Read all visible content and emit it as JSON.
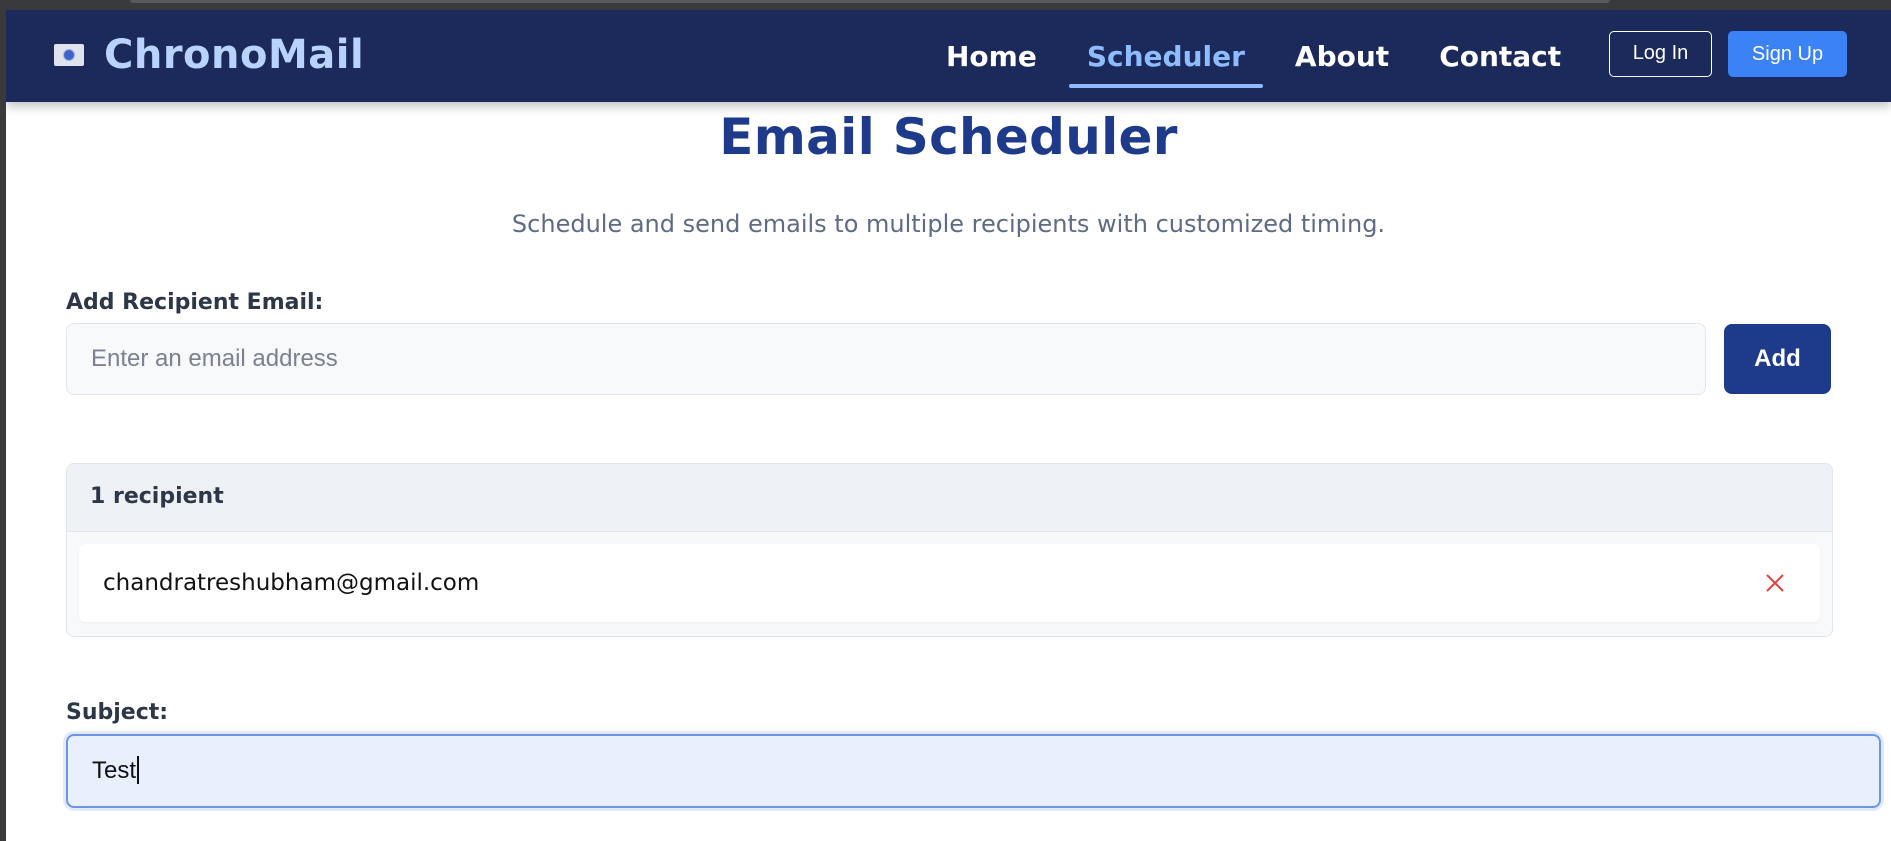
{
  "navbar": {
    "brand_icon": "envelope-icon",
    "brand_name": "ChronoMail",
    "links": [
      {
        "label": "Home",
        "active": false
      },
      {
        "label": "Scheduler",
        "active": true
      },
      {
        "label": "About",
        "active": false
      },
      {
        "label": "Contact",
        "active": false
      }
    ],
    "login_label": "Log In",
    "signup_label": "Sign Up"
  },
  "main": {
    "title": "Email Scheduler",
    "subtitle": "Schedule and send emails to multiple recipients with customized timing.",
    "recipient_label": "Add Recipient Email:",
    "recipient_placeholder": "Enter an email address",
    "add_label": "Add",
    "recipients_count": "1 recipient",
    "recipients": [
      {
        "email": "chandratreshubham@gmail.com",
        "remove_icon": "close-icon"
      }
    ],
    "subject_label": "Subject:",
    "subject_value": "Test"
  },
  "colors": {
    "navbar_bg": "#1b2a5a",
    "brand": "#b9d3ff",
    "accent": "#3b82f6",
    "primary": "#1e3a8a",
    "remove": "#e53e3e"
  }
}
